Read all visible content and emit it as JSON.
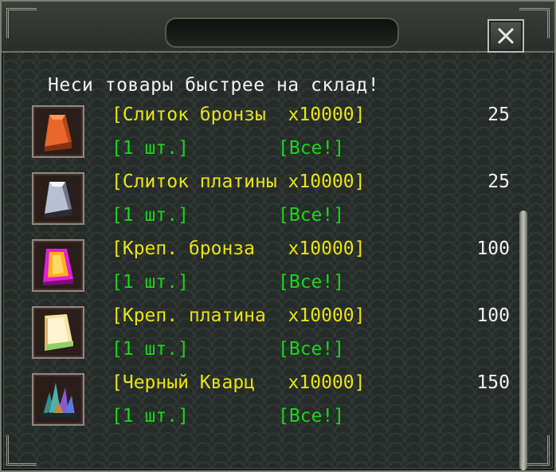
{
  "window": {
    "title": "",
    "close_glyph": "✕"
  },
  "header_text": "Неси товары быстрее на склад!",
  "colors": {
    "item_name": "#e8e415",
    "action": "#19d619",
    "price": "#f2f2f2"
  },
  "items": [
    {
      "name": "[Слиток бронзы  x10000]",
      "price": "25",
      "one_label": "[1 шт.]",
      "all_label": "[Все!]",
      "icon": "bronze-ingot-icon"
    },
    {
      "name": "[Слиток платины x10000]",
      "price": "25",
      "one_label": "[1 шт.]",
      "all_label": "[Все!]",
      "icon": "platinum-ingot-icon"
    },
    {
      "name": "[Креп. бронза   x10000]",
      "price": "100",
      "one_label": "[1 шт.]",
      "all_label": "[Все!]",
      "icon": "reinforced-bronze-icon"
    },
    {
      "name": "[Креп. платина  x10000]",
      "price": "100",
      "one_label": "[1 шт.]",
      "all_label": "[Все!]",
      "icon": "reinforced-platinum-icon"
    },
    {
      "name": "[Черный Кварц   x10000]",
      "price": "150",
      "one_label": "[1 шт.]",
      "all_label": "[Все!]",
      "icon": "black-quartz-icon"
    }
  ]
}
